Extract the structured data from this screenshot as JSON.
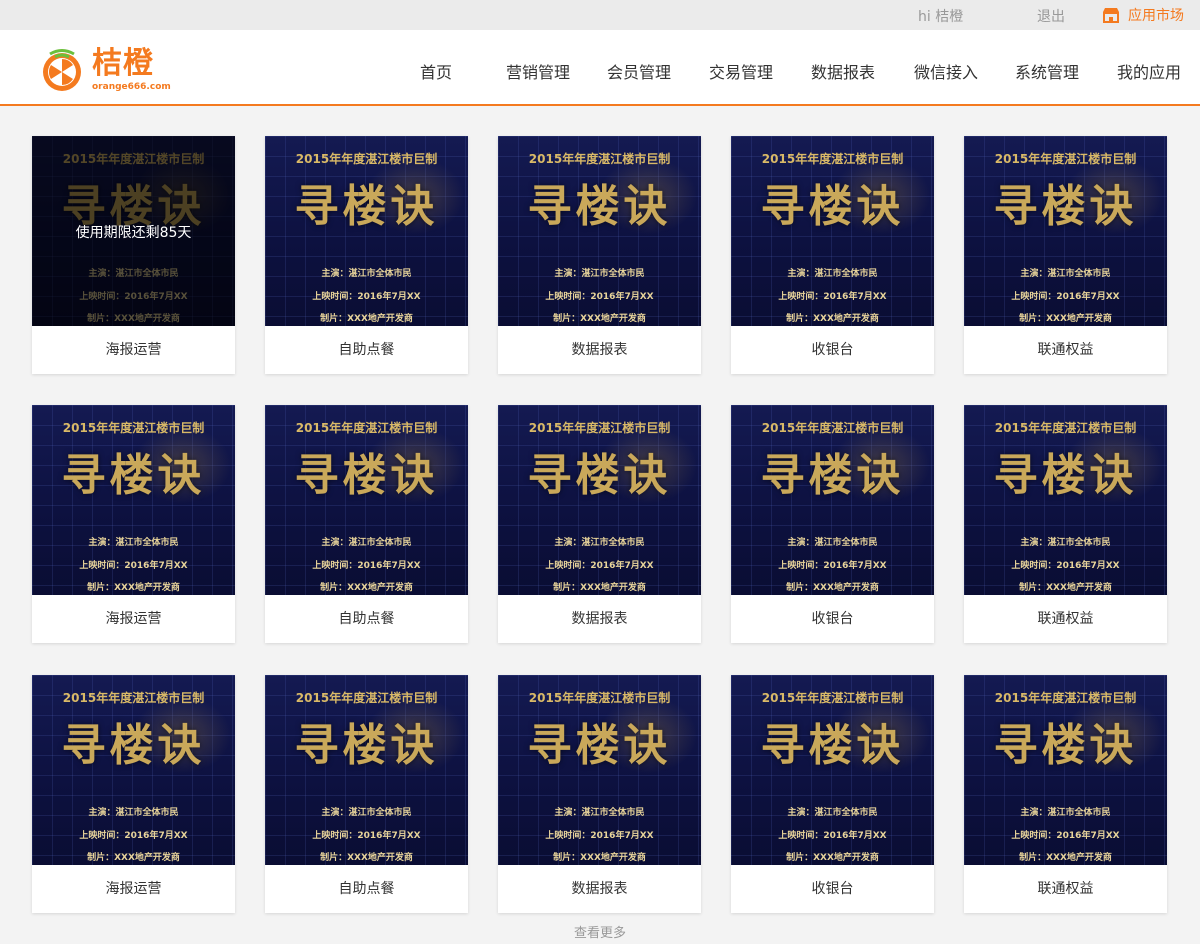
{
  "topbar": {
    "greeting": "hi  桔橙",
    "logout": "退出",
    "market": "应用市场",
    "market_icon": "store-icon"
  },
  "brand": {
    "name": "桔橙",
    "url": "orange666.com",
    "accent": "#f47a1f"
  },
  "nav": [
    {
      "label": "首页"
    },
    {
      "label": "营销管理"
    },
    {
      "label": "会员管理"
    },
    {
      "label": "交易管理"
    },
    {
      "label": "数据报表"
    },
    {
      "label": "微信接入"
    },
    {
      "label": "系统管理"
    },
    {
      "label": "我的应用"
    }
  ],
  "poster": {
    "year_line": "2015年年度湛江楼市巨制",
    "big_title": "寻楼诀",
    "line1": "主演：湛江市全体市民",
    "line2": "上映时间：2016年7月XX",
    "line3": "制片：XXX地产开发商"
  },
  "cards": [
    {
      "label": "海报运营",
      "overlay": "使用期限还剩85天"
    },
    {
      "label": "自助点餐"
    },
    {
      "label": "数据报表"
    },
    {
      "label": "收银台"
    },
    {
      "label": "联通权益"
    },
    {
      "label": "海报运营"
    },
    {
      "label": "自助点餐"
    },
    {
      "label": "数据报表"
    },
    {
      "label": "收银台"
    },
    {
      "label": "联通权益"
    },
    {
      "label": "海报运营"
    },
    {
      "label": "自助点餐"
    },
    {
      "label": "数据报表"
    },
    {
      "label": "收银台"
    },
    {
      "label": "联通权益"
    }
  ],
  "load_more": "查看更多"
}
